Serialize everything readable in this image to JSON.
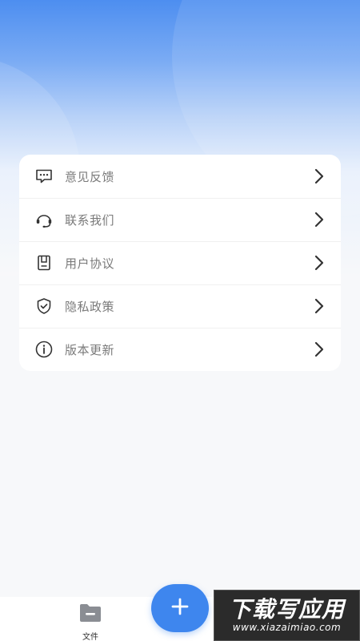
{
  "menu": {
    "items": [
      {
        "label": "意见反馈",
        "icon": "feedback-chat-icon"
      },
      {
        "label": "联系我们",
        "icon": "headset-icon"
      },
      {
        "label": "用户协议",
        "icon": "document-icon"
      },
      {
        "label": "隐私政策",
        "icon": "shield-check-icon"
      },
      {
        "label": "版本更新",
        "icon": "info-icon"
      }
    ]
  },
  "tabbar": {
    "files_label": "文件",
    "files_icon": "folder-minus-icon",
    "fab_icon": "plus-icon"
  },
  "watermark": {
    "main": "下载写应用",
    "sub": "www.xiazaimiao.com"
  },
  "colors": {
    "accent": "#3e86ee",
    "header_top": "#4d8ef0",
    "background": "#f7f8fa",
    "label": "#7a7a7a"
  }
}
